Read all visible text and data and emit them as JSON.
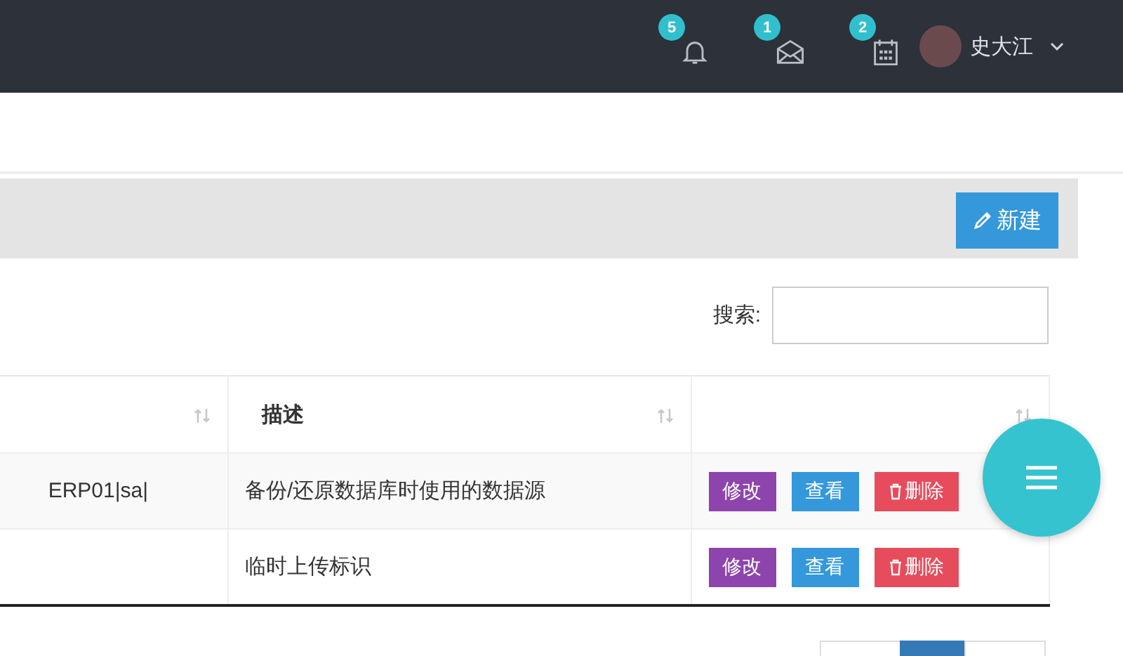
{
  "header": {
    "notifications": [
      {
        "kind": "bell",
        "count": "5"
      },
      {
        "kind": "mail",
        "count": "1"
      },
      {
        "kind": "calendar",
        "count": "2"
      }
    ],
    "user": {
      "name": "史大江"
    }
  },
  "toolbar": {
    "new_button": "新建"
  },
  "search": {
    "label": "搜索:"
  },
  "table": {
    "columns": [
      {
        "sortable": true
      },
      {
        "label": "描述",
        "sortable": true
      },
      {
        "sortable": true
      }
    ],
    "rows": [
      {
        "column_1": "ERP01|sa|",
        "description": "备份/还原数据库时使用的数据源",
        "actions": [
          {
            "kind": "edit",
            "label": "修改"
          },
          {
            "kind": "view",
            "label": "查看"
          },
          {
            "kind": "delete",
            "label": "删除"
          }
        ]
      },
      {
        "description": "临时上传标识",
        "actions": [
          {
            "kind": "edit",
            "label": "修改"
          },
          {
            "kind": "view",
            "label": "查看"
          },
          {
            "kind": "delete",
            "label": "删除"
          }
        ]
      }
    ]
  },
  "pagination": {
    "pages": [
      {
        "selected": false
      },
      {
        "selected": true
      },
      {
        "selected": false
      }
    ]
  }
}
